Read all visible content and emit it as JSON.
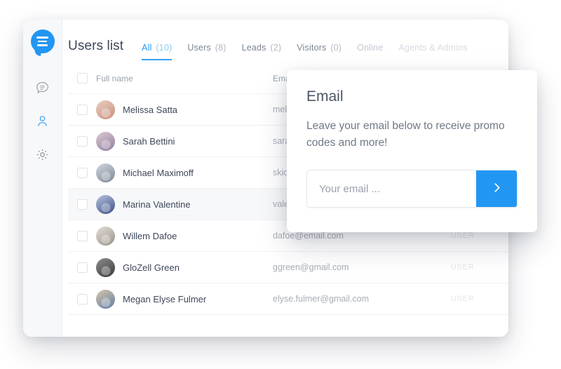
{
  "theme": {
    "accent": "#2196f3",
    "text_dark": "#3d4859",
    "text_muted": "#9aa1ac",
    "card_bg": "#ffffff",
    "sidebar_bg": "#f7f8fa"
  },
  "sidebar": {
    "logo_icon": "chat-bubble-logo",
    "items": [
      {
        "icon": "chat-bubble-outline-icon",
        "active": false
      },
      {
        "icon": "user-icon",
        "active": true
      },
      {
        "icon": "gear-icon",
        "active": false
      }
    ]
  },
  "header": {
    "title": "Users list",
    "tabs": [
      {
        "label": "All",
        "count": "(10)",
        "state": "active"
      },
      {
        "label": "Users",
        "count": "(8)",
        "state": "normal"
      },
      {
        "label": "Leads",
        "count": "(2)",
        "state": "normal"
      },
      {
        "label": "Visitors",
        "count": "(0)",
        "state": "normal"
      },
      {
        "label": "Online",
        "count": "",
        "state": "faded-1"
      },
      {
        "label": "Agents & Admins",
        "count": "",
        "state": "faded-2"
      }
    ]
  },
  "table": {
    "columns": {
      "name": "Full name",
      "email": "Email",
      "role": ""
    },
    "rows": [
      {
        "name": "Melissa Satta",
        "email": "mel",
        "role": "",
        "highlighted": false,
        "avatar": "linear-gradient(150deg,#e9cfc2,#c98f7b)"
      },
      {
        "name": "Sarah Bettini",
        "email": "sara",
        "role": "",
        "highlighted": false,
        "avatar": "linear-gradient(150deg,#dcc8d6,#8f7f9c)"
      },
      {
        "name": "Michael Maximoff",
        "email": "skid",
        "role": "",
        "highlighted": false,
        "avatar": "linear-gradient(150deg,#cfd6de,#7d8794)"
      },
      {
        "name": "Marina Valentine",
        "email": "vale",
        "role": "",
        "highlighted": true,
        "avatar": "linear-gradient(150deg,#b9c4e0,#3c4f86)"
      },
      {
        "name": "Willem Dafoe",
        "email": "dafoe@email.com",
        "role": "USER",
        "highlighted": false,
        "avatar": "linear-gradient(150deg,#e3ded8,#9a9088)"
      },
      {
        "name": "GloZell Green",
        "email": "ggreen@gmail.com",
        "role": "USER",
        "highlighted": false,
        "avatar": "linear-gradient(150deg,#8d8d8d,#3a3a3a)"
      },
      {
        "name": "Megan Elyse Fulmer",
        "email": "elyse.fulmer@gmail.com",
        "role": "USER",
        "highlighted": false,
        "avatar": "linear-gradient(150deg,#d8c6a8,#5f7ea8)"
      }
    ]
  },
  "popup": {
    "title": "Email",
    "body": "Leave your email below to receive promo codes and more!",
    "input_placeholder": "Your email ...",
    "input_value": "",
    "submit_icon": "chevron-right-icon",
    "submit_color": "#2196f3"
  }
}
